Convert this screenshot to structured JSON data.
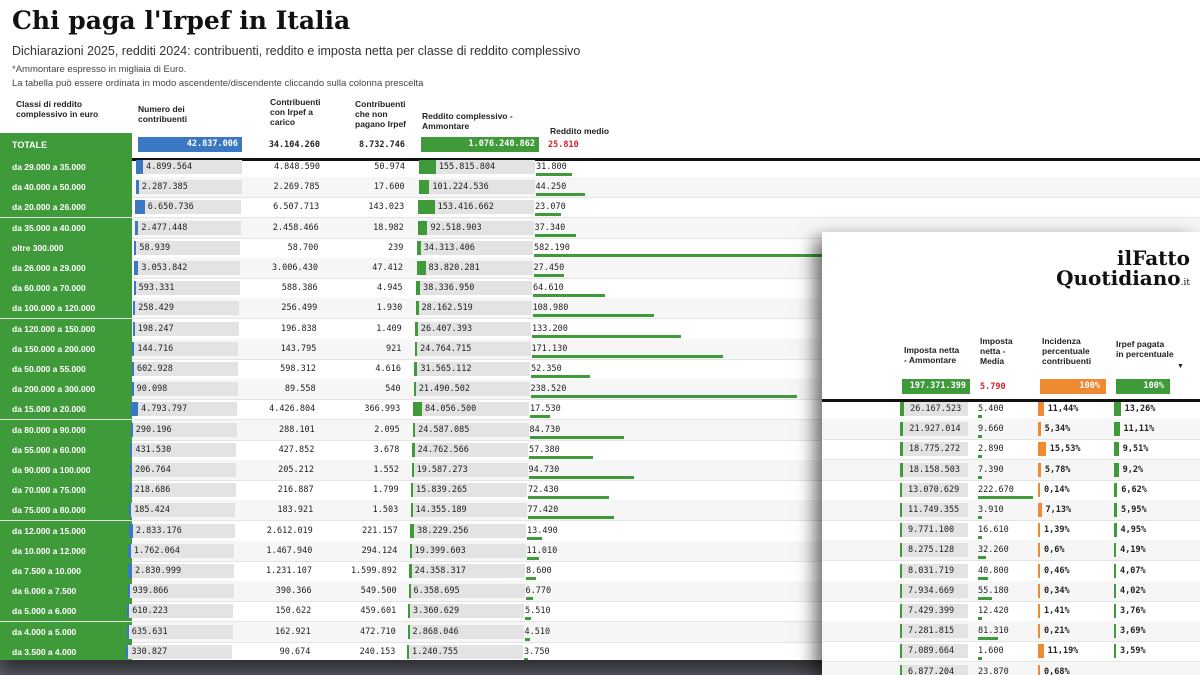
{
  "title": "Chi paga l'Irpef in Italia",
  "subtitle": "Dichiarazioni 2025, redditi 2024: contribuenti, reddito e imposta netta per classe di reddito complessivo",
  "note_amount": "*Ammontare espresso in migliaia di Euro.",
  "note_sort": "La tabella può essere ordinata in modo ascendente/discendente cliccando sulla colonna prescelta",
  "headers": {
    "classi": "Classi di reddito complessivo in euro",
    "numero": "Numero dei contribuenti",
    "con_irpef": "Contribuenti con Irpef a carico",
    "non_pagano": "Contribuenti che non pagano Irpef",
    "reddito_amm": "Reddito complessivo - Ammontare",
    "reddito_medio": "Reddito medio",
    "imposta_amm": "Imposta netta - Ammontare",
    "imposta_media": "Imposta netta - Media",
    "incidenza": "Incidenza percentuale contribuenti",
    "irpef_pct": "Irpef pagata in percentuale"
  },
  "colors": {
    "green": "#3f9a3a",
    "blue": "#3b78c4",
    "orange": "#ef8a33",
    "red": "#d4202a"
  },
  "total": {
    "label": "TOTALE",
    "numero": "42.837.006",
    "con_irpef": "34.104.260",
    "non_pagano": "8.732.746",
    "reddito_amm": "1.076.240.862",
    "reddito_medio": "25.810",
    "imposta_amm": "197.371.399",
    "imposta_media": "5.790",
    "incidenza": "100%",
    "irpef_pct": "100%"
  },
  "logo": {
    "line1": "ilFatto",
    "line2": "Quotidiano",
    "suffix": ".it"
  },
  "rows": [
    {
      "cls": "da 29.000 a 35.000",
      "num": "4.899.564",
      "numf": 0.114,
      "con": "4.848.590",
      "non": "50.974",
      "red": "155.815.804",
      "redf": 0.145,
      "med": "31.800",
      "medf": 0.055
    },
    {
      "cls": "da 40.000 a 50.000",
      "num": "2.287.385",
      "numf": 0.053,
      "con": "2.269.785",
      "non": "17.600",
      "red": "101.224.536",
      "redf": 0.094,
      "med": "44.250",
      "medf": 0.076
    },
    {
      "cls": "da 20.000 a 26.000",
      "num": "6.650.736",
      "numf": 0.155,
      "con": "6.507.713",
      "non": "143.023",
      "red": "153.416.662",
      "redf": 0.143,
      "med": "23.070",
      "medf": 0.04
    },
    {
      "cls": "da 35.000 a 40.000",
      "num": "2.477.448",
      "numf": 0.058,
      "con": "2.458.466",
      "non": "18.982",
      "red": "92.518.903",
      "redf": 0.086,
      "med": "37.340",
      "medf": 0.064
    },
    {
      "cls": "oltre 300.000",
      "num": "58.939",
      "numf": 0.0014,
      "con": "58.700",
      "non": "239",
      "red": "34.313.406",
      "redf": 0.032,
      "med": "582.190",
      "medf": 1.0
    },
    {
      "cls": "da 26.000 a 29.000",
      "num": "3.053.842",
      "numf": 0.071,
      "con": "3.006.430",
      "non": "47.412",
      "red": "83.820.281",
      "redf": 0.078,
      "med": "27.450",
      "medf": 0.047
    },
    {
      "cls": "da 60.000 a 70.000",
      "num": "593.331",
      "numf": 0.014,
      "con": "588.386",
      "non": "4.945",
      "red": "38.336.950",
      "redf": 0.036,
      "med": "64.610",
      "medf": 0.111
    },
    {
      "cls": "da 100.000 a 120.000",
      "num": "258.429",
      "numf": 0.006,
      "con": "256.499",
      "non": "1.930",
      "red": "28.162.519",
      "redf": 0.026,
      "med": "108.980",
      "medf": 0.187
    },
    {
      "cls": "da 120.000 a 150.000",
      "num": "198.247",
      "numf": 0.0046,
      "con": "196.838",
      "non": "1.409",
      "red": "26.407.393",
      "redf": 0.025,
      "med": "133.200",
      "medf": 0.229
    },
    {
      "cls": "da 150.000 a 200.000",
      "num": "144.716",
      "numf": 0.0034,
      "con": "143.795",
      "non": "921",
      "red": "24.764.715",
      "redf": 0.023,
      "med": "171.130",
      "medf": 0.294
    },
    {
      "cls": "da 50.000 a 55.000",
      "num": "602.928",
      "numf": 0.014,
      "con": "598.312",
      "non": "4.616",
      "red": "31.565.112",
      "redf": 0.029,
      "med": "52.350",
      "medf": 0.09
    },
    {
      "cls": "da 200.000 a 300.000",
      "num": "90.098",
      "numf": 0.0021,
      "con": "89.558",
      "non": "540",
      "red": "21.490.502",
      "redf": 0.02,
      "med": "238.520",
      "medf": 0.41
    },
    {
      "cls": "da 15.000 a 20.000",
      "num": "4.793.797",
      "numf": 0.112,
      "con": "4.426.804",
      "non": "366.993",
      "red": "84.056.500",
      "redf": 0.078,
      "med": "17.530",
      "medf": 0.03
    },
    {
      "cls": "da 80.000 a 90.000",
      "num": "290.196",
      "numf": 0.0068,
      "con": "288.101",
      "non": "2.095",
      "red": "24.587.085",
      "redf": 0.023,
      "med": "84.730",
      "medf": 0.146
    },
    {
      "cls": "da 55.000 a 60.000",
      "num": "431.530",
      "numf": 0.01,
      "con": "427.852",
      "non": "3.678",
      "red": "24.762.566",
      "redf": 0.023,
      "med": "57.380",
      "medf": 0.099
    },
    {
      "cls": "da 90.000 a 100.000",
      "num": "206.764",
      "numf": 0.0048,
      "con": "205.212",
      "non": "1.552",
      "red": "19.587.273",
      "redf": 0.018,
      "med": "94.730",
      "medf": 0.163
    },
    {
      "cls": "da 70.000 a 75.000",
      "num": "218.686",
      "numf": 0.0051,
      "con": "216.887",
      "non": "1.799",
      "red": "15.839.265",
      "redf": 0.015,
      "med": "72.430",
      "medf": 0.124
    },
    {
      "cls": "da 75.000 a 80.000",
      "num": "185.424",
      "numf": 0.0043,
      "con": "183.921",
      "non": "1.503",
      "red": "14.355.189",
      "redf": 0.013,
      "med": "77.420",
      "medf": 0.133
    },
    {
      "cls": "da 12.000 a 15.000",
      "num": "2.833.176",
      "numf": 0.066,
      "con": "2.612.019",
      "non": "221.157",
      "red": "38.229.256",
      "redf": 0.036,
      "med": "13.490",
      "medf": 0.023
    },
    {
      "cls": "da 10.000 a 12.000",
      "num": "1.762.064",
      "numf": 0.041,
      "con": "1.467.940",
      "non": "294.124",
      "red": "19.399.603",
      "redf": 0.018,
      "med": "11.010",
      "medf": 0.019
    },
    {
      "cls": "da 7.500 a 10.000",
      "num": "2.830.999",
      "numf": 0.066,
      "con": "1.231.107",
      "non": "1.599.892",
      "red": "24.358.317",
      "redf": 0.023,
      "med": "8.600",
      "medf": 0.015
    },
    {
      "cls": "da 6.000 a 7.500",
      "num": "939.866",
      "numf": 0.022,
      "con": "390.366",
      "non": "549.500",
      "red": "6.358.695",
      "redf": 0.006,
      "med": "6.770",
      "medf": 0.012
    },
    {
      "cls": "da 5.000 a 6.000",
      "num": "610.223",
      "numf": 0.014,
      "con": "150.622",
      "non": "459.601",
      "red": "3.360.629",
      "redf": 0.003,
      "med": "5.510",
      "medf": 0.009
    },
    {
      "cls": "da 4.000 a 5.000",
      "num": "635.631",
      "numf": 0.015,
      "con": "162.921",
      "non": "472.710",
      "red": "2.868.046",
      "redf": 0.0027,
      "med": "4.510",
      "medf": 0.008
    },
    {
      "cls": "da 3.500 a 4.000",
      "num": "330.827",
      "numf": 0.0077,
      "con": "90.674",
      "non": "240.153",
      "red": "1.240.755",
      "redf": 0.0012,
      "med": "3.750",
      "medf": 0.006
    }
  ],
  "inset_rows": [
    {
      "amm": "26.167.523",
      "ammf": 0.133,
      "media": "5.400",
      "medf": 0.024,
      "inc": "11,44%",
      "incf": 0.114,
      "irp": "13,26%",
      "irpf": 0.133
    },
    {
      "amm": "21.927.014",
      "ammf": 0.111,
      "media": "9.660",
      "medf": 0.043,
      "inc": "5,34%",
      "incf": 0.053,
      "irp": "11,11%",
      "irpf": 0.111
    },
    {
      "amm": "18.775.272",
      "ammf": 0.095,
      "media": "2.890",
      "medf": 0.013,
      "inc": "15,53%",
      "incf": 0.155,
      "irp": "9,51%",
      "irpf": 0.095
    },
    {
      "amm": "18.158.503",
      "ammf": 0.092,
      "media": "7.390",
      "medf": 0.033,
      "inc": "5,78%",
      "incf": 0.058,
      "irp": "9,2%",
      "irpf": 0.092
    },
    {
      "amm": "13.070.629",
      "ammf": 0.066,
      "media": "222.670",
      "medf": 1.0,
      "inc": "0,14%",
      "incf": 0.0014,
      "irp": "6,62%",
      "irpf": 0.066
    },
    {
      "amm": "11.749.355",
      "ammf": 0.06,
      "media": "3.910",
      "medf": 0.018,
      "inc": "7,13%",
      "incf": 0.071,
      "irp": "5,95%",
      "irpf": 0.06
    },
    {
      "amm": "9.771.100",
      "ammf": 0.05,
      "media": "16.610",
      "medf": 0.075,
      "inc": "1,39%",
      "incf": 0.014,
      "irp": "4,95%",
      "irpf": 0.05
    },
    {
      "amm": "8.275.128",
      "ammf": 0.042,
      "media": "32.260",
      "medf": 0.145,
      "inc": "0,6%",
      "incf": 0.006,
      "irp": "4,19%",
      "irpf": 0.042
    },
    {
      "amm": "8.031.719",
      "ammf": 0.041,
      "media": "40.800",
      "medf": 0.183,
      "inc": "0,46%",
      "incf": 0.0046,
      "irp": "4,07%",
      "irpf": 0.041
    },
    {
      "amm": "7.934.669",
      "ammf": 0.04,
      "media": "55.180",
      "medf": 0.248,
      "inc": "0,34%",
      "incf": 0.0034,
      "irp": "4,02%",
      "irpf": 0.04
    },
    {
      "amm": "7.429.399",
      "ammf": 0.038,
      "media": "12.420",
      "medf": 0.056,
      "inc": "1,41%",
      "incf": 0.014,
      "irp": "3,76%",
      "irpf": 0.038
    },
    {
      "amm": "7.281.815",
      "ammf": 0.037,
      "media": "81.310",
      "medf": 0.365,
      "inc": "0,21%",
      "incf": 0.0021,
      "irp": "3,69%",
      "irpf": 0.037
    },
    {
      "amm": "7.089.664",
      "ammf": 0.036,
      "media": "1.600",
      "medf": 0.007,
      "inc": "11,19%",
      "incf": 0.112,
      "irp": "3,59%",
      "irpf": 0.036
    },
    {
      "amm": "6.877.204",
      "ammf": 0.035,
      "media": "23.870",
      "medf": 0.107,
      "inc": "0,68%",
      "incf": 0.0068,
      "irp": "",
      "irpf": 0.0
    }
  ]
}
